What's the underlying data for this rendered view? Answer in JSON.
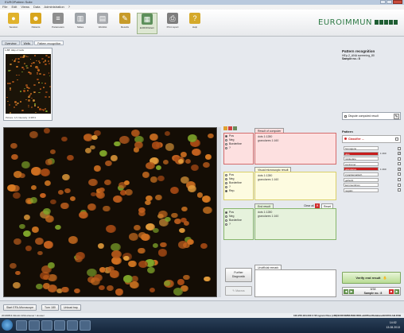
{
  "window": {
    "title": "EUROPattern Suite"
  },
  "menu": [
    "File",
    "Edit",
    "Views",
    "Data",
    "Administration",
    "?"
  ],
  "toolbar": {
    "buttons": [
      {
        "label": "Session",
        "icon": "session-icon",
        "color": "#e0b22c"
      },
      {
        "label": "Patients",
        "icon": "patients-icon",
        "color": "#d8a51d"
      },
      {
        "label": "Parameters",
        "icon": "parameters-icon",
        "color": "#8e8e8e"
      },
      {
        "label": "Slides",
        "icon": "slides-icon",
        "color": "#9ea3a8"
      },
      {
        "label": "Worklist",
        "icon": "worklist-icon",
        "color": "#a6a9ad"
      },
      {
        "label": "Results",
        "icon": "results-icon",
        "color": "#c79b2a"
      },
      {
        "label": "EUROPattern",
        "icon": "europattern-icon",
        "color": "#5c8f5a"
      },
      {
        "label": "Print report",
        "icon": "print-icon",
        "color": "#7d7d7d"
      },
      {
        "label": "Help",
        "icon": "help-icon",
        "color": "#d5a92a"
      }
    ],
    "brand": "EUROIMMUN"
  },
  "left_tabs": [
    "Overview",
    "Wells",
    "Pattern recognition"
  ],
  "preview": {
    "header": "1-B8: HEp-2 Cells",
    "info": "Picture: 1/1    Intensity: 0.3874"
  },
  "right_info": {
    "title": "Pattern recognition",
    "line2": "HEp-2_ANA screening_80",
    "line3": "Sample no.: 8"
  },
  "dispute": {
    "label": "Dispute computed result"
  },
  "computer": {
    "tab": "Result of computer",
    "options": [
      "Pos",
      "Neg",
      "Borderline",
      "?"
    ],
    "selected": 0,
    "lines": [
      "dots 1:1280",
      "granulares 1:160"
    ],
    "bg": "#fde0e0",
    "border": "#d46c6c"
  },
  "visual": {
    "tab": "Visual microscopic result",
    "options": [
      "Pos",
      "Neg",
      "Borderline",
      "?",
      "Rep."
    ],
    "selected": 4,
    "lines": [
      "dots 1:1280",
      "granulares 1:160"
    ],
    "bg": "#fdfbe0",
    "border": "#d9cf6a"
  },
  "end": {
    "tab": "End result",
    "options": [
      "Pos",
      "Neg",
      "Borderline",
      "?"
    ],
    "selected": 0,
    "lines": [
      "dots 1:1280",
      "granulares 1:160"
    ],
    "clear_all": "Clear all",
    "reset": "Reset",
    "bg": "#e6f2dc",
    "border": "#86b56b"
  },
  "further": {
    "label1": "Further",
    "label2": "Diagnostic",
    "macro": "Macros"
  },
  "remark": {
    "tab": "Unofficial remark"
  },
  "pattern": {
    "header": "Pattern",
    "classifier": "Classifier ...",
    "rows": [
      {
        "name": "homogene",
        "value": "",
        "red": false,
        "checked": false
      },
      {
        "name": "dots",
        "value": "1:160",
        "red": true,
        "checked": true
      },
      {
        "name": "nukleolare",
        "value": "",
        "red": false,
        "checked": false
      },
      {
        "name": "zentromer",
        "value": "",
        "red": false,
        "checked": false
      },
      {
        "name": "granulares",
        "value": "1:160",
        "red": true,
        "checked": true
      },
      {
        "name": "zytoplasmatisch",
        "value": "",
        "red": false,
        "checked": false
      },
      {
        "name": "gefleckt",
        "value": "",
        "red": false,
        "checked": false
      },
      {
        "name": "kernmembran",
        "value": "",
        "red": false,
        "checked": false
      },
      {
        "name": "negativ",
        "value": "",
        "red": false,
        "checked": false
      }
    ]
  },
  "verify": {
    "label": "Verify end result"
  },
  "sample_nav": {
    "count": "8/38",
    "label": "Sample no.: 8"
  },
  "bottom": {
    "buttons": [
      "Start EFA-Microscope",
      "Turn 180",
      "Unload tray"
    ]
  },
  "status": {
    "left": "20130813-3Hostz-ANA    elouser / elouser",
    "right": "100.256.184.230 C:\\Program Files (x86)\\EUROIMMUN\\EUROLabOffice\\Database\\EUROLAB.FDB"
  },
  "taskbar": {
    "time": "14:02",
    "date": "13.08.2013"
  }
}
